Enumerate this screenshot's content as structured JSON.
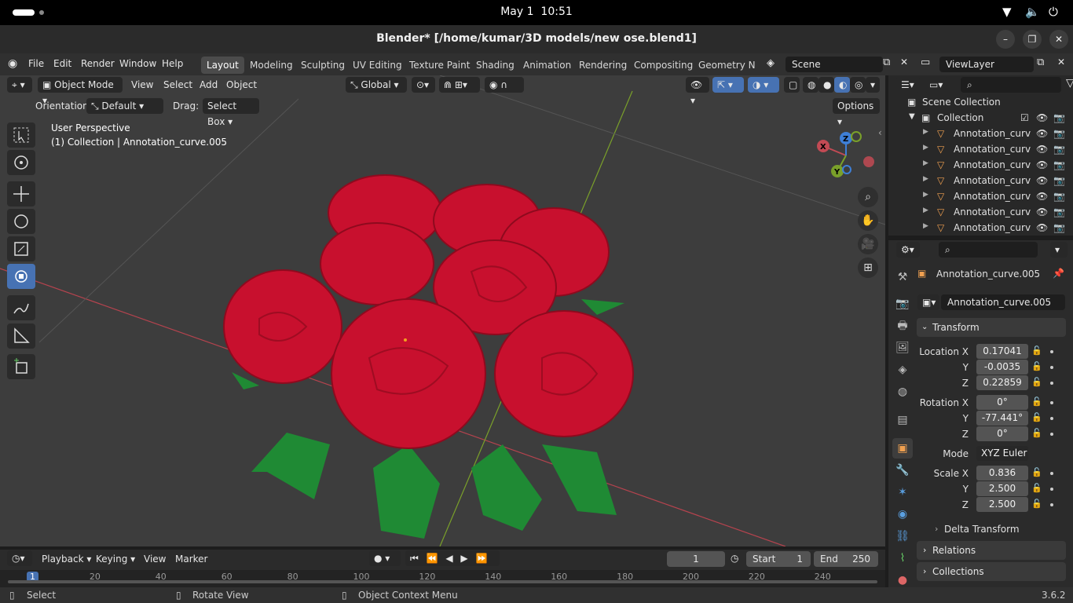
{
  "system": {
    "date": "May 1",
    "time": "10:51"
  },
  "window": {
    "title": "Blender* [/home/kumar/3D models/new ose.blend1]"
  },
  "menus": [
    "File",
    "Edit",
    "Render",
    "Window",
    "Help"
  ],
  "workspaces": [
    "Layout",
    "Modeling",
    "Sculpting",
    "UV Editing",
    "Texture Paint",
    "Shading",
    "Animation",
    "Rendering",
    "Compositing",
    "Geometry Noc"
  ],
  "scene": "Scene",
  "view_layer": "ViewLayer",
  "viewport": {
    "mode": "Object Mode",
    "menu": [
      "View",
      "Select",
      "Add",
      "Object"
    ],
    "transform_orientation": "Global",
    "orientation_label": "Orientation:",
    "orientation_value": "Default",
    "drag_label": "Drag:",
    "drag_value": "Select Box",
    "options": "Options",
    "perspective": "User Perspective",
    "collection_info": "(1) Collection | Annotation_curve.005",
    "gizmo": {
      "x": "X",
      "y": "Y",
      "z": "Z"
    }
  },
  "outliner": {
    "root": "Scene Collection",
    "collection": "Collection",
    "items": [
      "Annotation_curv",
      "Annotation_curv",
      "Annotation_curv",
      "Annotation_curv",
      "Annotation_curv",
      "Annotation_curv",
      "Annotation_curv"
    ]
  },
  "properties": {
    "object_name": "Annotation_curve.005",
    "datablock": "Annotation_curve.005",
    "transform_header": "Transform",
    "location_label": "Location X",
    "location": [
      "0.17041",
      "-0.0035",
      "0.22859"
    ],
    "rotation_label": "Rotation X",
    "rotation": [
      "0°",
      "-77.441°",
      "0°"
    ],
    "mode_label": "Mode",
    "mode": "XYZ Euler",
    "scale_label": "Scale X",
    "scale": [
      "0.836",
      "2.500",
      "2.500"
    ],
    "axis_y": "Y",
    "axis_z": "Z",
    "delta": "Delta Transform",
    "relations": "Relations",
    "collections": "Collections"
  },
  "timeline": {
    "menus": [
      "Playback",
      "Keying",
      "View",
      "Marker"
    ],
    "current_frame": "1",
    "start_label": "Start",
    "start": "1",
    "end_label": "End",
    "end": "250",
    "ruler": [
      "1",
      "20",
      "40",
      "60",
      "80",
      "100",
      "120",
      "140",
      "160",
      "180",
      "200",
      "220",
      "240"
    ]
  },
  "statusbar": {
    "select": "Select",
    "rotate": "Rotate View",
    "context": "Object Context Menu",
    "version": "3.6.2"
  },
  "colors": {
    "accent": "#4772b3",
    "rose": "#c8102e",
    "leaf": "#1f8a34",
    "x_axis": "#c24a54",
    "y_axis": "#7aa02a"
  }
}
